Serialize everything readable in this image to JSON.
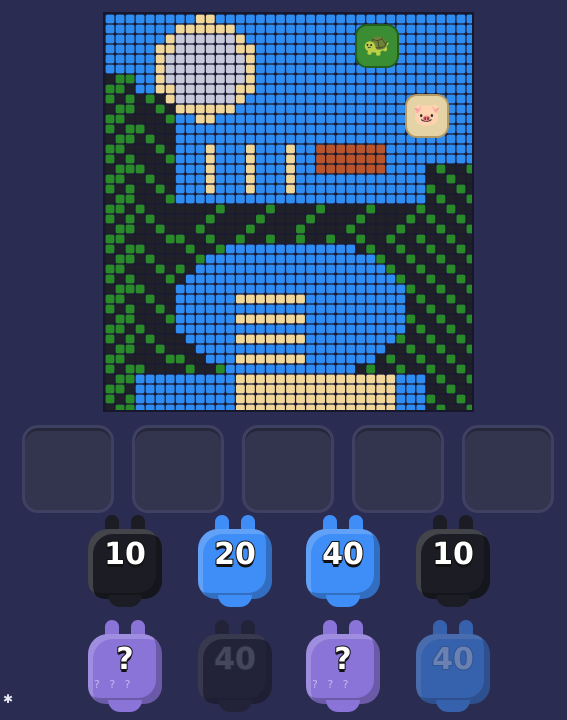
{
  "board": {
    "colors": {
      "sky": "#2f8cf0",
      "moon_fill": "#c9c9dc",
      "cream": "#f2d79a",
      "green": "#2a8a2a",
      "dark": "#1f2028",
      "water": "#2e8cf2",
      "brown": "#b8552c"
    },
    "tokens": [
      {
        "name": "green-token",
        "icon": "turtle-icon",
        "color": "#3b8d34"
      },
      {
        "name": "cream-token",
        "icon": "pig-icon",
        "color": "#e6d3a5"
      }
    ]
  },
  "slots": {
    "count": 5
  },
  "jars": {
    "row1": [
      {
        "label": "10",
        "color": "black"
      },
      {
        "label": "20",
        "color": "blue"
      },
      {
        "label": "40",
        "color": "blue"
      },
      {
        "label": "10",
        "color": "black"
      }
    ],
    "row2": [
      {
        "label": "?",
        "color": "mystery"
      },
      {
        "label": "40",
        "color": "black"
      },
      {
        "label": "?",
        "color": "mystery"
      },
      {
        "label": "40",
        "color": "blue"
      }
    ]
  },
  "settings_icon": "gear-icon"
}
